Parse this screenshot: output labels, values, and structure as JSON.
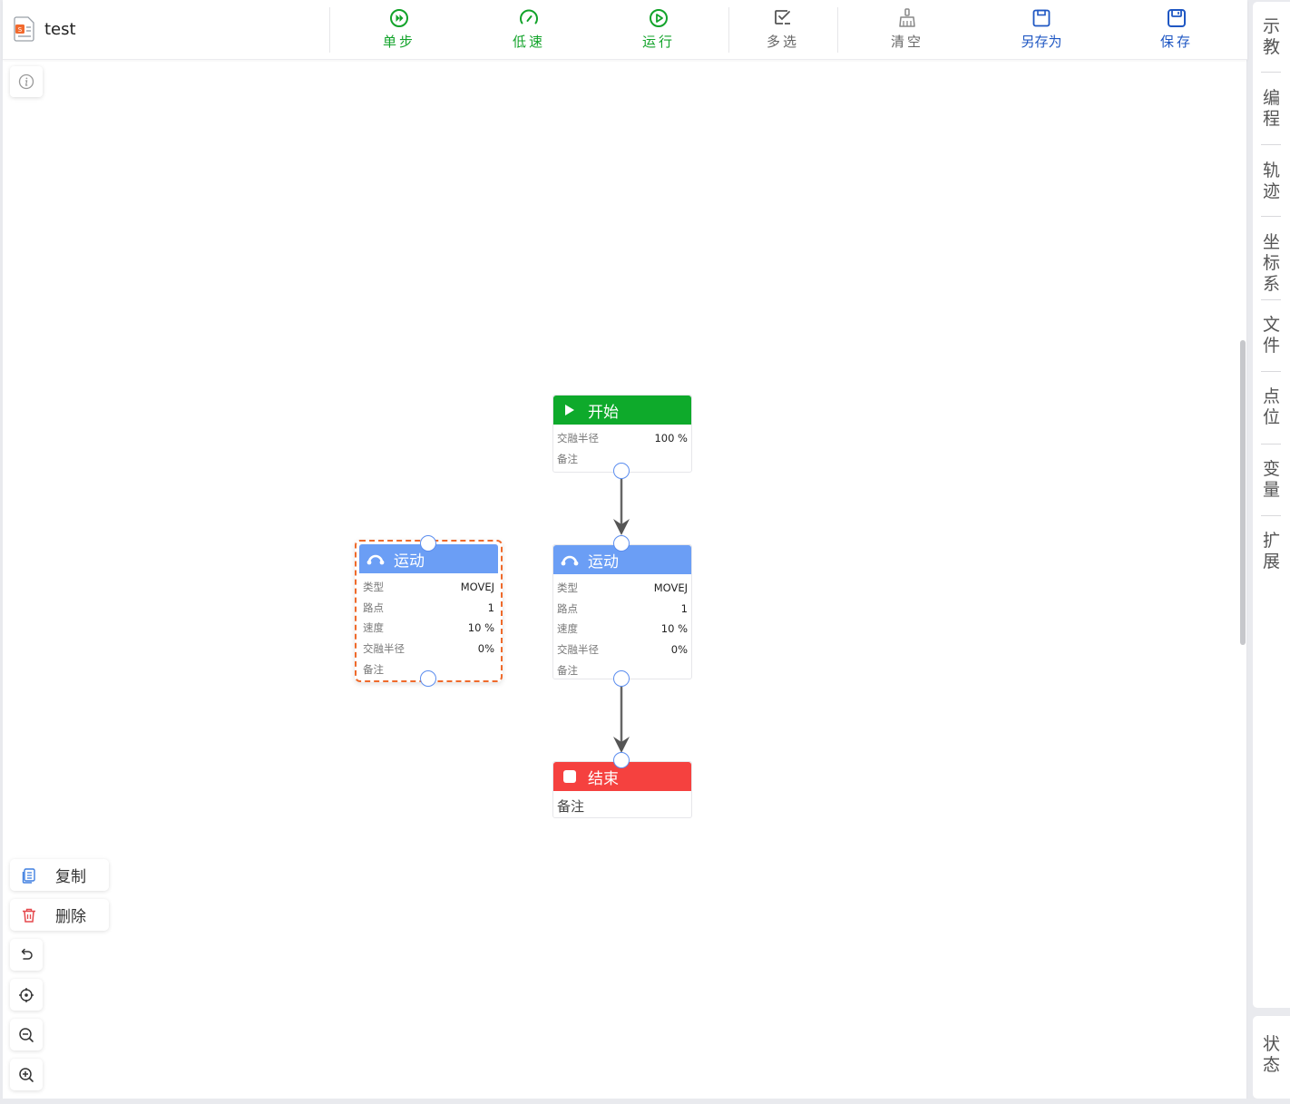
{
  "file": {
    "name": "test"
  },
  "toolbar": {
    "step": {
      "label": "单步",
      "color": "#12a32a"
    },
    "low_speed": {
      "label": "低速",
      "color": "#12a32a"
    },
    "run": {
      "label": "运行",
      "color": "#12a32a"
    },
    "multi_select": {
      "label": "多选",
      "color": "#666666"
    },
    "clear": {
      "label": "清空",
      "color": "#666666"
    },
    "save_as": {
      "label": "另存为",
      "color": "#1f57c3"
    },
    "save": {
      "label": "保存",
      "color": "#1f57c3"
    }
  },
  "nodes": {
    "start": {
      "title": "开始",
      "color": "#0eaa2b",
      "props": [
        {
          "key": "交融半径",
          "value": "100 %"
        },
        {
          "key": "备注",
          "value": ""
        }
      ]
    },
    "motion_selected": {
      "title": "运动",
      "color": "#6b9ef5",
      "props": [
        {
          "key": "类型",
          "value": "MOVEJ"
        },
        {
          "key": "路点",
          "value": "1"
        },
        {
          "key": "速度",
          "value": "10 %"
        },
        {
          "key": "交融半径",
          "value": "0%"
        },
        {
          "key": "备注",
          "value": ""
        }
      ]
    },
    "motion": {
      "title": "运动",
      "color": "#6b9ef5",
      "props": [
        {
          "key": "类型",
          "value": "MOVEJ"
        },
        {
          "key": "路点",
          "value": "1"
        },
        {
          "key": "速度",
          "value": "10 %"
        },
        {
          "key": "交融半径",
          "value": "0%"
        },
        {
          "key": "备注",
          "value": ""
        }
      ]
    },
    "end": {
      "title": "结束",
      "color": "#f5413f",
      "note": "备注"
    }
  },
  "actions": {
    "copy": "复制",
    "delete": "删除"
  },
  "side_panel": {
    "items": [
      "示教",
      "编程",
      "轨迹",
      "坐标系",
      "文件",
      "点位",
      "变量",
      "扩展"
    ],
    "status": "状态"
  }
}
